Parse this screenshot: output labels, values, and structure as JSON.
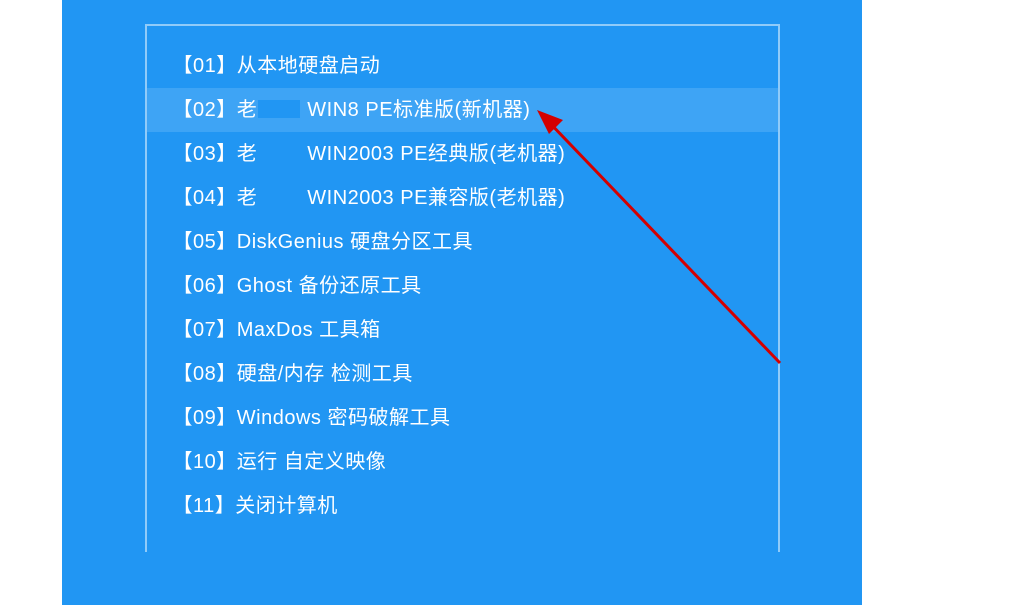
{
  "menu": {
    "items": [
      {
        "num": "01",
        "prefix": "",
        "label": "从本地硬盘启动",
        "censored": false,
        "selected": false
      },
      {
        "num": "02",
        "prefix": "老",
        "label": " WIN8 PE标准版(新机器)",
        "censored": true,
        "selected": true
      },
      {
        "num": "03",
        "prefix": "老",
        "label": " WIN2003 PE经典版(老机器)",
        "censored": true,
        "selected": false
      },
      {
        "num": "04",
        "prefix": "老",
        "label": " WIN2003 PE兼容版(老机器)",
        "censored": true,
        "selected": false
      },
      {
        "num": "05",
        "prefix": "",
        "label": "DiskGenius 硬盘分区工具",
        "censored": false,
        "selected": false
      },
      {
        "num": "06",
        "prefix": "",
        "label": "Ghost 备份还原工具",
        "censored": false,
        "selected": false
      },
      {
        "num": "07",
        "prefix": "",
        "label": "MaxDos 工具箱",
        "censored": false,
        "selected": false
      },
      {
        "num": "08",
        "prefix": "",
        "label": "硬盘/内存 检测工具",
        "censored": false,
        "selected": false
      },
      {
        "num": "09",
        "prefix": "",
        "label": "Windows 密码破解工具",
        "censored": false,
        "selected": false
      },
      {
        "num": "10",
        "prefix": "",
        "label": "运行 自定义映像",
        "censored": false,
        "selected": false
      },
      {
        "num": "11",
        "prefix": "",
        "label": "关闭计算机",
        "censored": false,
        "selected": false
      }
    ]
  }
}
